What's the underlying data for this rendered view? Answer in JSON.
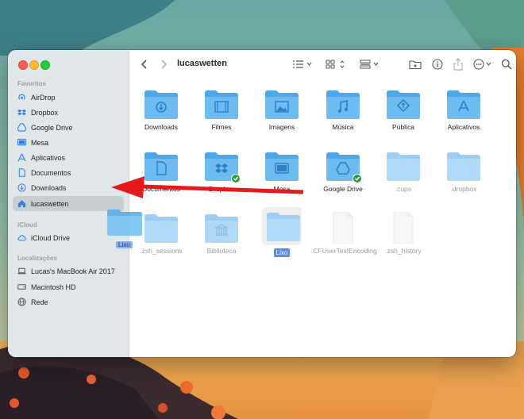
{
  "window": {
    "title": "lucaswetten"
  },
  "sidebar": {
    "favorites_header": "Favoritos",
    "favorites": [
      {
        "label": "AirDrop",
        "icon": "airdrop-icon"
      },
      {
        "label": "Dropbox",
        "icon": "dropbox-icon"
      },
      {
        "label": "Google Drive",
        "icon": "google-drive-icon"
      },
      {
        "label": "Mesa",
        "icon": "desktop-icon"
      },
      {
        "label": "Aplicativos",
        "icon": "applications-icon"
      },
      {
        "label": "Documentos",
        "icon": "document-icon"
      },
      {
        "label": "Downloads",
        "icon": "download-icon"
      },
      {
        "label": "lucaswetten",
        "icon": "home-icon"
      }
    ],
    "icloud_header": "iCloud",
    "icloud": [
      {
        "label": "iCloud Drive",
        "icon": "cloud-icon"
      }
    ],
    "locations_header": "Localizações",
    "locations": [
      {
        "label": "Lucas's MacBook Air 2017",
        "icon": "laptop-icon"
      },
      {
        "label": "Macintosh HD",
        "icon": "disk-icon"
      },
      {
        "label": "Rede",
        "icon": "globe-icon"
      }
    ]
  },
  "toolbar": {
    "back": "back-chevron-icon",
    "forward": "forward-chevron-icon",
    "view_list": "list-view-icon",
    "view_grid": "grid-view-icon",
    "group": "group-icon",
    "new_folder": "new-folder-icon",
    "info": "info-icon",
    "share": "share-icon",
    "more": "more-icon",
    "search": "search-icon"
  },
  "files": [
    {
      "label": "Downloads",
      "kind": "download"
    },
    {
      "label": "Filmes",
      "kind": "movies"
    },
    {
      "label": "Imagens",
      "kind": "pictures"
    },
    {
      "label": "Música",
      "kind": "music"
    },
    {
      "label": "Pública",
      "kind": "public"
    },
    {
      "label": "Aplicativos",
      "kind": "apps"
    },
    {
      "label": "Documentos",
      "kind": "doc"
    },
    {
      "label": "Dropbox",
      "kind": "dropbox"
    },
    {
      "label": "Mesa",
      "kind": "desktop"
    },
    {
      "label": "Google Drive",
      "kind": "gdrive"
    },
    {
      "label": ".cups",
      "kind": "hidden"
    },
    {
      "label": ".dropbox",
      "kind": "hidden"
    },
    {
      "label": ".zsh_sessions",
      "kind": "hidden"
    },
    {
      "label": "Biblioteca",
      "kind": "library"
    },
    {
      "label": "Lixo",
      "kind": "renaming"
    },
    {
      "label": ".CFUserTextEncoding",
      "kind": "file"
    },
    {
      "label": ".zsh_history",
      "kind": "file"
    }
  ],
  "drag": {
    "label": "Lixo"
  },
  "colors": {
    "accent": "#5b8de6",
    "folder": "#5ab3ec",
    "arrow": "#e8191c"
  }
}
